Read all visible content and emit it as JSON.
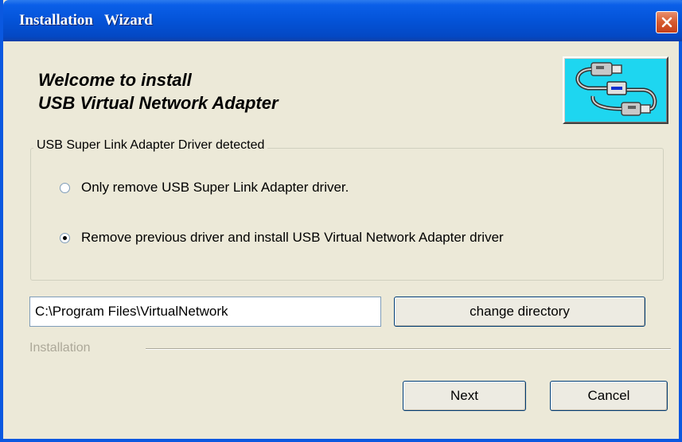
{
  "window": {
    "title": "Installation   Wizard"
  },
  "header": {
    "welcome_line1": "Welcome to install",
    "welcome_line2": "USB Virtual Network Adapter",
    "logo_icon": "usb-cable-icon",
    "logo_bg_color": "#1ED6F0"
  },
  "group": {
    "legend": "USB Super Link Adapter Driver detected",
    "options": [
      {
        "label": "Only remove USB Super Link Adapter driver.",
        "checked": false
      },
      {
        "label": "Remove previous driver and install USB Virtual Network Adapter driver",
        "checked": true
      }
    ]
  },
  "directory": {
    "value": "C:\\Program Files\\VirtualNetwork",
    "change_label": "change directory"
  },
  "progress": {
    "label": "Installation",
    "value": 0
  },
  "buttons": {
    "next": "Next",
    "cancel": "Cancel"
  },
  "colors": {
    "titlebar": "#0453D8",
    "face": "#ECE9D8",
    "close": "#D65A2E"
  }
}
